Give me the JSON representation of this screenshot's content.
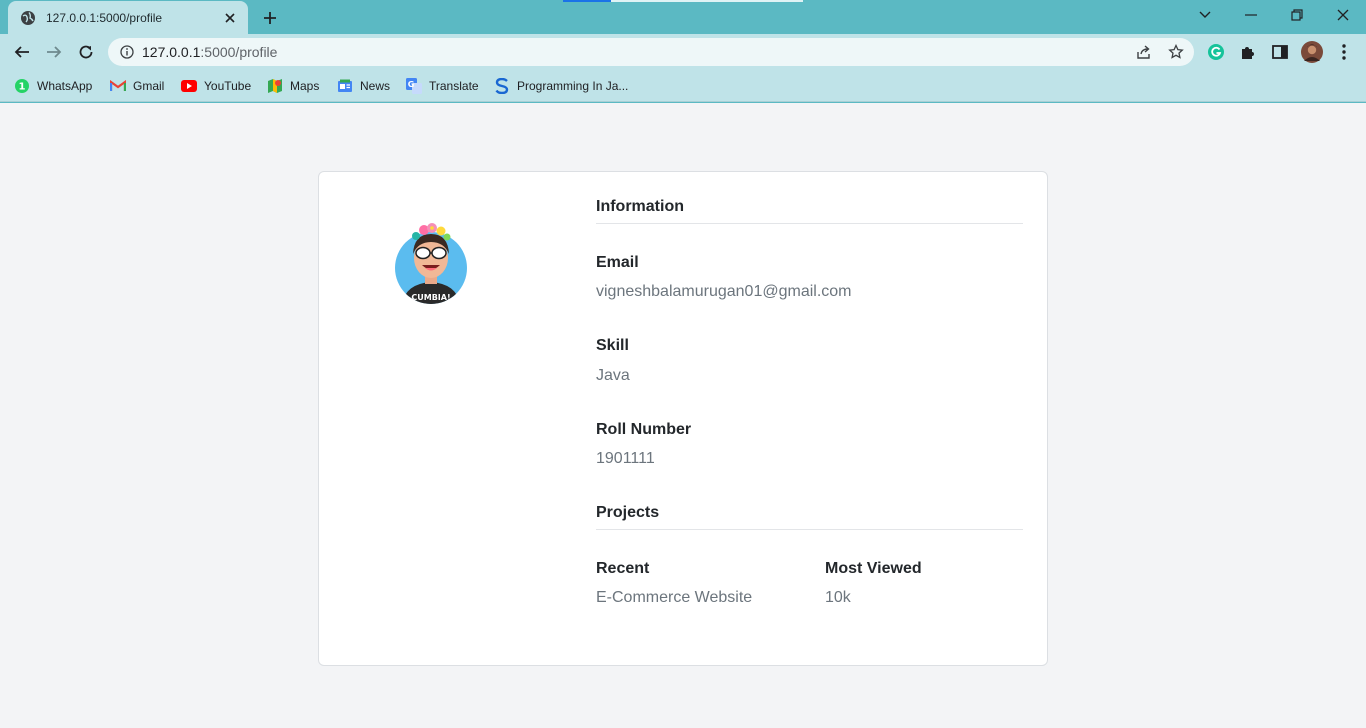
{
  "browser": {
    "tab_title": "127.0.0.1:5000/profile",
    "url_host": "127.0.0.1",
    "url_path": ":5000/profile",
    "accent": "#5bb9c3"
  },
  "bookmarks": [
    {
      "label": "WhatsApp",
      "icon": "whatsapp-icon"
    },
    {
      "label": "Gmail",
      "icon": "gmail-icon"
    },
    {
      "label": "YouTube",
      "icon": "youtube-icon"
    },
    {
      "label": "Maps",
      "icon": "maps-icon"
    },
    {
      "label": "News",
      "icon": "news-icon"
    },
    {
      "label": "Translate",
      "icon": "translate-icon"
    },
    {
      "label": "Programming In Ja...",
      "icon": "bookmark-s-icon"
    }
  ],
  "profile": {
    "avatar_caption": "CUMBIA!",
    "information_heading": "Information",
    "email_label": "Email",
    "email_value": "vigneshbalamurugan01@gmail.com",
    "skill_label": "Skill",
    "skill_value": "Java",
    "roll_label": "Roll Number",
    "roll_value": "1901111",
    "projects_heading": "Projects",
    "recent_label": "Recent",
    "recent_value": "E-Commerce Website",
    "most_viewed_label": "Most Viewed",
    "most_viewed_value": "10k"
  }
}
